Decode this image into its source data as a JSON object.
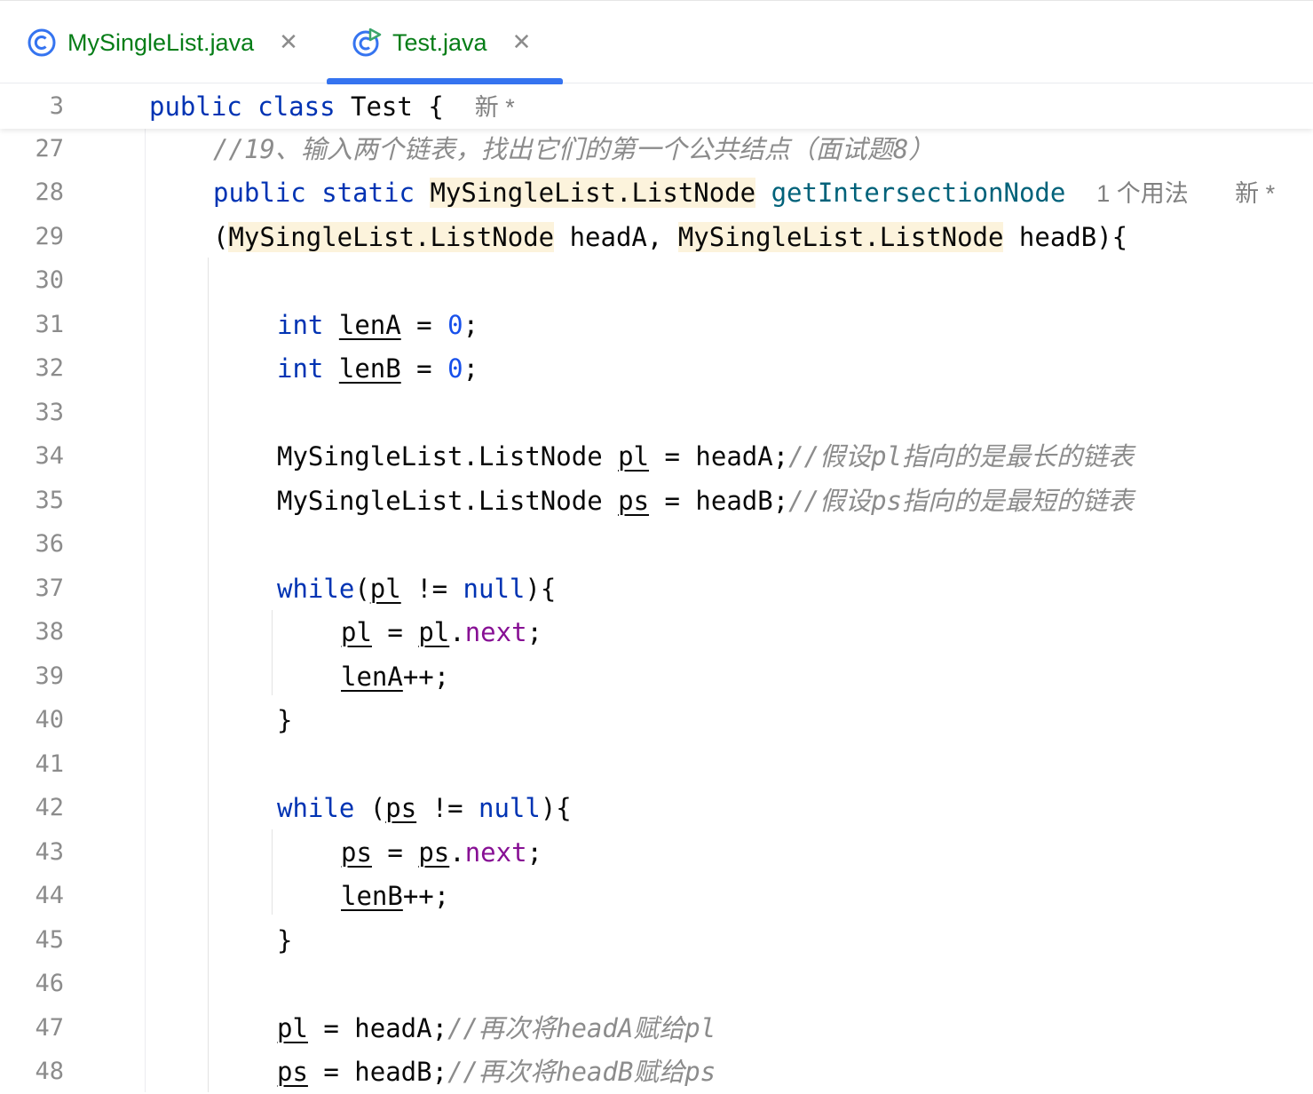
{
  "tabs": [
    {
      "label": "MySingleList.java",
      "icon": "class-icon",
      "active": false
    },
    {
      "label": "Test.java",
      "icon": "runnable-class-icon",
      "active": true
    }
  ],
  "close_glyph": "✕",
  "sticky": {
    "line": "3",
    "t1": "public",
    "t2": "class",
    "t3": "Test {",
    "hint": "新 *"
  },
  "lines": {
    "l27": {
      "n": "27",
      "c1": "//19、输入两个链表，找出它们的第一个公共结点（面试题8）"
    },
    "l28": {
      "n": "28",
      "t1": "public",
      "t2": "static",
      "t3": "MySingleList.ListNode",
      "t4": "getIntersectionNode",
      "h1": "1 个用法",
      "h2": "新 *"
    },
    "l29": {
      "n": "29",
      "t1": "(",
      "t2": "MySingleList.ListNode",
      "t3": " headA, ",
      "t4": "MySingleList.ListNode",
      "t5": " headB){"
    },
    "l30": {
      "n": "30"
    },
    "l31": {
      "n": "31",
      "t1": "int",
      "t2": "lenA",
      "t3": " = ",
      "t4": "0",
      "t5": ";"
    },
    "l32": {
      "n": "32",
      "t1": "int",
      "t2": "lenB",
      "t3": " = ",
      "t4": "0",
      "t5": ";"
    },
    "l33": {
      "n": "33"
    },
    "l34": {
      "n": "34",
      "t1": "MySingleList.ListNode ",
      "t2": "pl",
      "t3": " = headA;",
      "c1": "//假设pl指向的是最长的链表"
    },
    "l35": {
      "n": "35",
      "t1": "MySingleList.ListNode ",
      "t2": "ps",
      "t3": " = headB;",
      "c1": "//假设ps指向的是最短的链表"
    },
    "l36": {
      "n": "36"
    },
    "l37": {
      "n": "37",
      "t1": "while",
      "t2": "(",
      "t3": "pl",
      "t4": " != ",
      "t5": "null",
      "t6": "){"
    },
    "l38": {
      "n": "38",
      "t1": "pl",
      "t2": " = ",
      "t3": "pl",
      "t4": ".",
      "t5": "next",
      "t6": ";"
    },
    "l39": {
      "n": "39",
      "t1": "lenA",
      "t2": "++;"
    },
    "l40": {
      "n": "40",
      "t1": "}"
    },
    "l41": {
      "n": "41"
    },
    "l42": {
      "n": "42",
      "t1": "while",
      "t2": " (",
      "t3": "ps",
      "t4": " != ",
      "t5": "null",
      "t6": "){"
    },
    "l43": {
      "n": "43",
      "t1": "ps",
      "t2": " = ",
      "t3": "ps",
      "t4": ".",
      "t5": "next",
      "t6": ";"
    },
    "l44": {
      "n": "44",
      "t1": "lenB",
      "t2": "++;"
    },
    "l45": {
      "n": "45",
      "t1": "}"
    },
    "l46": {
      "n": "46"
    },
    "l47": {
      "n": "47",
      "t1": "pl",
      "t2": " = headA;",
      "c1": "//再次将headA赋给pl"
    },
    "l48": {
      "n": "48",
      "t1": "ps",
      "t2": " = headB;",
      "c1": "//再次将headB赋给ps"
    }
  },
  "colors": {
    "keyword": "#0033b3",
    "number": "#1750eb",
    "field": "#871094",
    "method": "#00627a",
    "comment": "#8c8c8c",
    "tab_text": "#067d17",
    "accent": "#3574f0"
  }
}
